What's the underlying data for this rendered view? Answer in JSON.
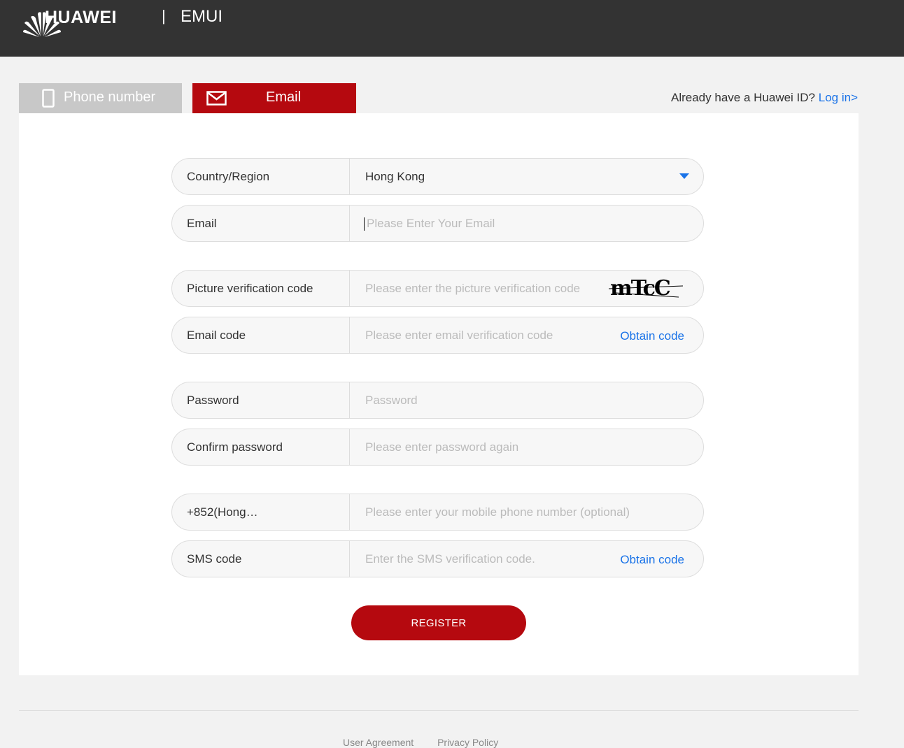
{
  "header": {
    "brand": "HUAWEI",
    "separator": "|",
    "product": "EMUI",
    "logo_icon": "huawei-logo-icon",
    "bg_color": "#333333"
  },
  "tabs": {
    "phone": {
      "label": "Phone number",
      "icon": "phone-icon",
      "active": false
    },
    "email": {
      "label": "Email",
      "icon": "mail-icon",
      "active": true
    }
  },
  "login_hint": {
    "text": "Already have a Huawei ID?",
    "link": "Log in>"
  },
  "form": {
    "country": {
      "label": "Country/Region",
      "value": "Hong Kong"
    },
    "email": {
      "label": "Email",
      "placeholder": "Please Enter Your Email"
    },
    "picture_code": {
      "label": "Picture verification code",
      "placeholder": "Please enter the picture verification code",
      "captcha_text": "mTcC"
    },
    "email_code": {
      "label": "Email code",
      "placeholder": "Please enter email verification code",
      "action": "Obtain code"
    },
    "password": {
      "label": "Password",
      "placeholder": "Password"
    },
    "confirm_password": {
      "label": "Confirm password",
      "placeholder": "Please enter password again"
    },
    "phone": {
      "label": "+852(Hong…",
      "placeholder": "Please enter your mobile phone number (optional)"
    },
    "sms_code": {
      "label": "SMS code",
      "placeholder": "Enter the SMS verification code.",
      "action": "Obtain code"
    },
    "register_label": "REGISTER"
  },
  "footer": {
    "links": [
      "User Agreement",
      "Privacy Policy"
    ]
  },
  "colors": {
    "accent_red": "#b5090f",
    "link_blue": "#1a73e8",
    "inactive_tab": "#c8c8c8"
  }
}
